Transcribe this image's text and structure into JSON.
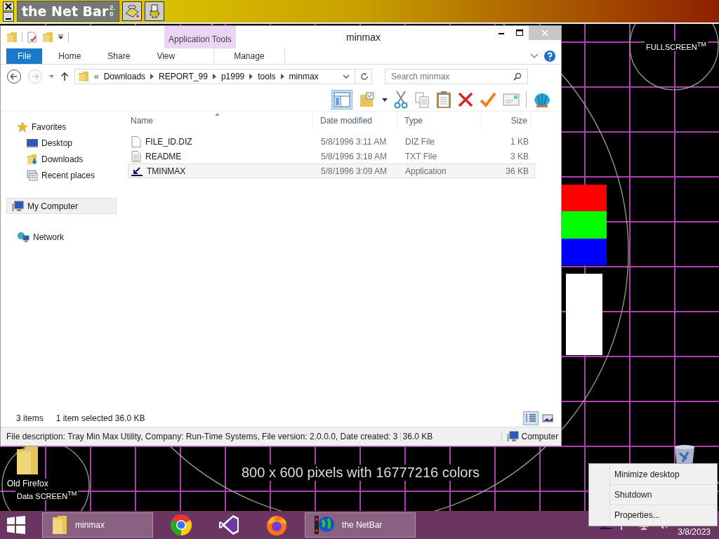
{
  "netbar": {
    "title": "the Net Bar",
    "version": "2.0"
  },
  "explorer": {
    "title": "minmax",
    "context_group": "Application Tools",
    "ribbon_tabs": [
      {
        "label": "File",
        "kind": "file"
      },
      {
        "label": "Home",
        "kind": "tab"
      },
      {
        "label": "Share",
        "kind": "tab"
      },
      {
        "label": "View",
        "kind": "tab"
      },
      {
        "label": "Manage",
        "kind": "context"
      }
    ],
    "breadcrumb": [
      "Downloads",
      "REPORT_99",
      "p1999",
      "tools",
      "minmax"
    ],
    "breadcrumb_overflow": "«",
    "search": {
      "placeholder": "Search minmax"
    },
    "nav": [
      {
        "label": "Favorites",
        "kind": "star",
        "selected": false,
        "children": [
          {
            "label": "Desktop",
            "kind": "desktop",
            "selected": false
          },
          {
            "label": "Downloads",
            "kind": "downloads",
            "selected": false
          },
          {
            "label": "Recent places",
            "kind": "recent",
            "selected": false
          }
        ]
      },
      {
        "label": "My Computer",
        "kind": "computer",
        "selected": true
      },
      {
        "label": "Network",
        "kind": "network",
        "selected": false
      }
    ],
    "columns": [
      "Name",
      "Date modified",
      "Type",
      "Size"
    ],
    "files": [
      {
        "name": "FILE_ID.DIZ",
        "date": "5/8/1996 3:11 AM",
        "type": "DIZ File",
        "size": "1 KB",
        "kind": "document",
        "selected": false
      },
      {
        "name": "README",
        "date": "5/8/1996 3:18 AM",
        "type": "TXT File",
        "size": "3 KB",
        "kind": "text",
        "selected": false
      },
      {
        "name": "TMINMAX",
        "date": "5/8/1996 3:09 AM",
        "type": "Application",
        "size": "36 KB",
        "kind": "application",
        "selected": true
      }
    ],
    "status": {
      "count": "3 items",
      "selection": "1 item selected  36.0 KB"
    },
    "view_buttons": [
      {
        "kind": "details",
        "selected": true
      },
      {
        "kind": "thumbnails",
        "selected": false
      }
    ],
    "details_bar": {
      "description": "File description: Tray Min Max Utility, Company: Run-Time Systems, File version: 2.0.0.0, Date created: 3",
      "size": "36.0 KB",
      "location": "Computer"
    }
  },
  "desktop": {
    "pattern_label": "FULLSCREEN$^{TM}$",
    "resolution_text": "800 x 600 pixels with 16777216 colors",
    "brand": "Data SCREEN$^{TM}$",
    "icons": [
      {
        "label": "Old Firefox",
        "kind": "folder"
      }
    ]
  },
  "taskbar": {
    "buttons": [
      {
        "label": "minmax",
        "kind": "folder"
      },
      {
        "kind": "chrome"
      },
      {
        "kind": "studio"
      },
      {
        "kind": "firefox"
      },
      {
        "label": "the NetBar",
        "kind": "netbar"
      }
    ],
    "date": "3/8/2023"
  },
  "context_menu": [
    "Minimize desktop",
    "Shutdown",
    "Properties..."
  ]
}
